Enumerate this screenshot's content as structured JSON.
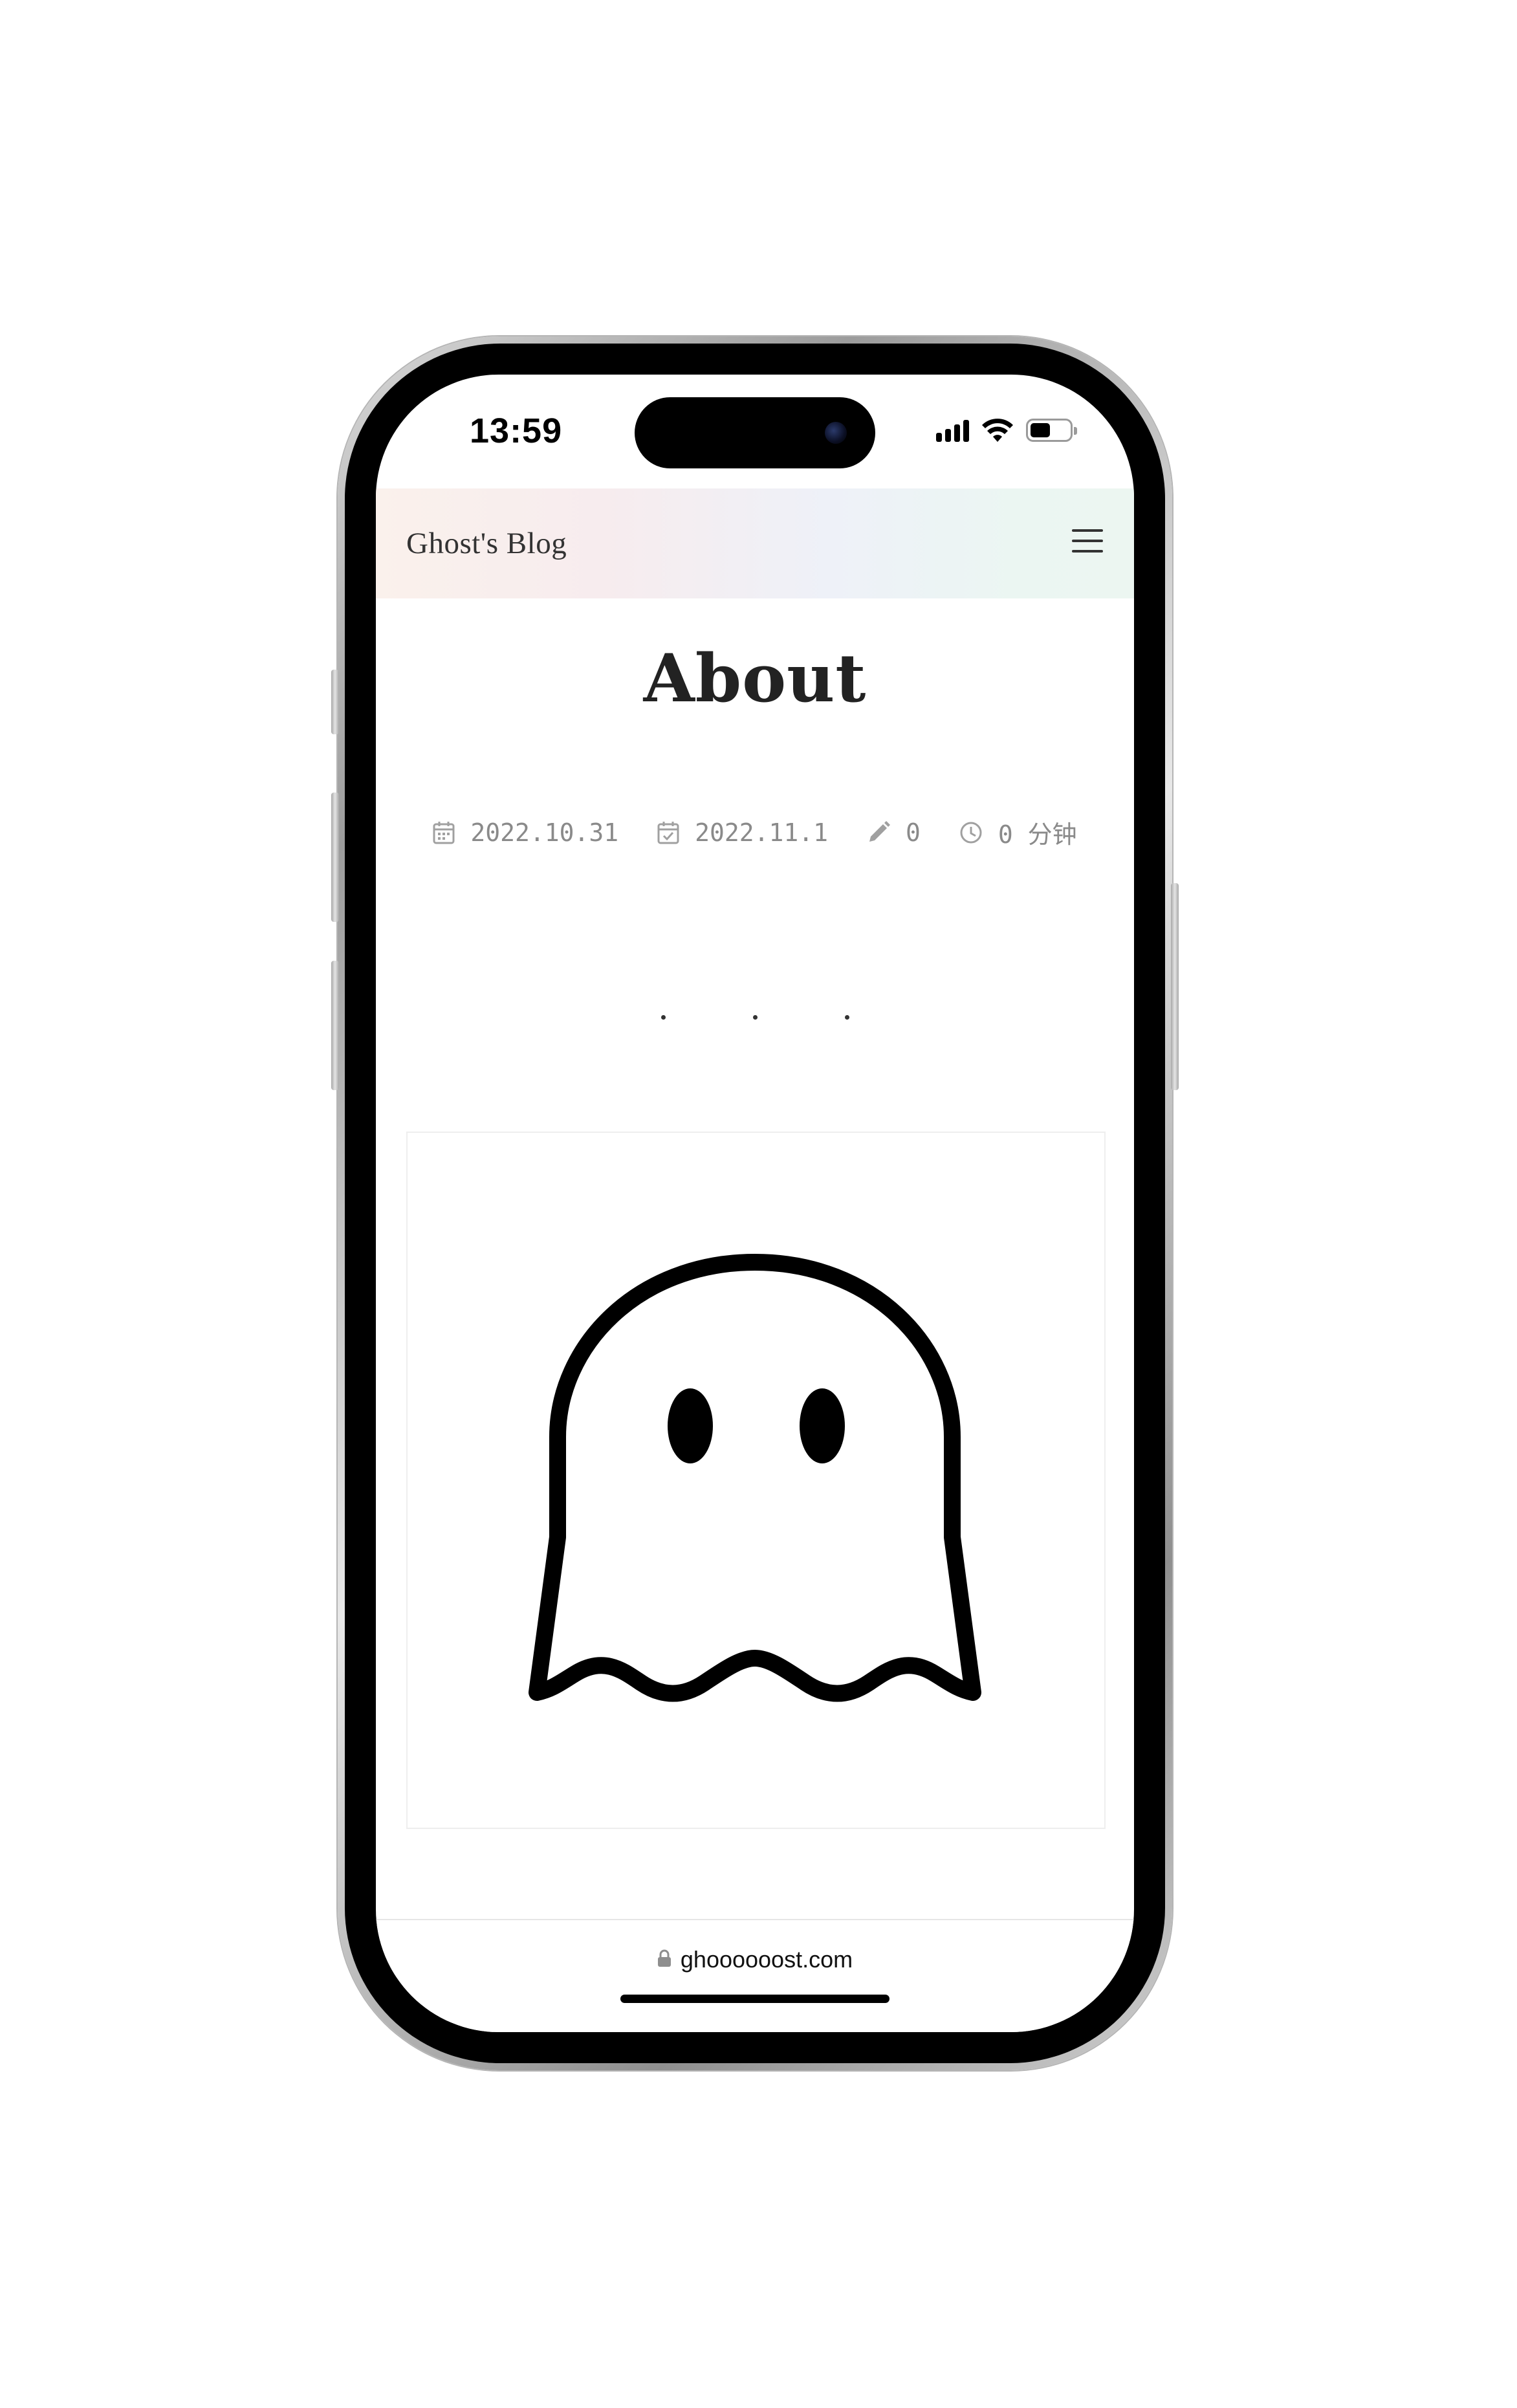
{
  "status_bar": {
    "time": "13:59"
  },
  "header": {
    "site_title": "Ghost's Blog",
    "menu_icon": "hamburger-menu-icon"
  },
  "page": {
    "title": "About",
    "meta": {
      "created_date": "2022.10.31",
      "updated_date": "2022.11.1",
      "word_count": "0",
      "reading_time": "0 分钟"
    },
    "image": "ghost-illustration"
  },
  "browser": {
    "url": "ghoooooost.com"
  },
  "colors": {
    "meta_text": "#8a8a8a",
    "title_text": "#222222",
    "header_gradient_start": "#faf1ec",
    "header_gradient_end": "#ecf6f1"
  }
}
